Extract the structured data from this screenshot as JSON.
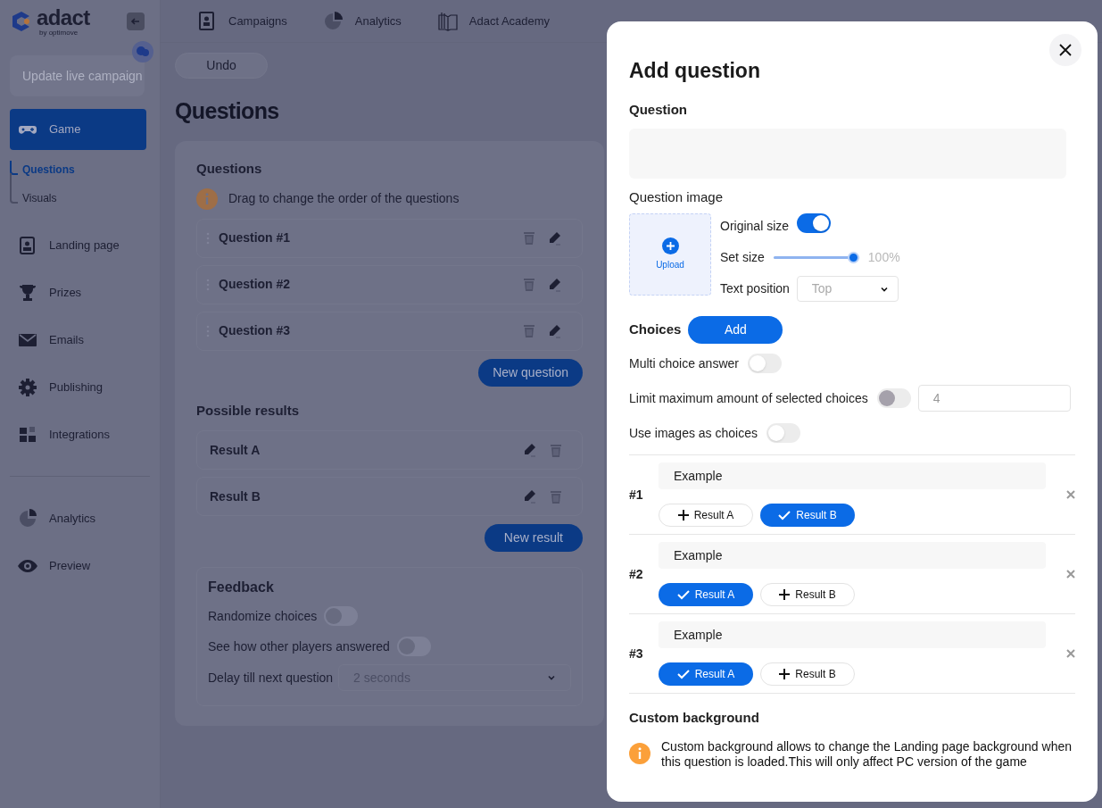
{
  "sidebar": {
    "logo": "adact",
    "logo_sub": "by optimove",
    "update_button": {
      "label": "Update live campaign",
      "disabled": true
    },
    "items": [
      {
        "label": "Game",
        "selected": true,
        "children": [
          {
            "label": "Questions",
            "selected": true
          },
          {
            "label": "Visuals",
            "selected": false
          }
        ]
      },
      {
        "label": "Landing page",
        "selected": false
      },
      {
        "label": "Prizes",
        "selected": false
      },
      {
        "label": "Emails",
        "selected": false
      },
      {
        "label": "Publishing",
        "selected": false
      },
      {
        "label": "Integrations",
        "selected": false
      }
    ],
    "bottom_items": [
      {
        "label": "Analytics",
        "selected": false
      },
      {
        "label": "Preview",
        "selected": false
      }
    ]
  },
  "top_nav": [
    "Campaigns",
    "Analytics",
    "Adact Academy"
  ],
  "undo_button": "Undo",
  "page_title": "Questions",
  "questions_section": {
    "title": "Questions",
    "hint": "Drag to change the order of the questions",
    "rows": [
      "Question #1",
      "Question #2",
      "Question #3"
    ],
    "new_button": "New question"
  },
  "results_section": {
    "title": "Possible results",
    "rows": [
      "Result A",
      "Result B"
    ],
    "new_button": "New result"
  },
  "feedback": {
    "title": "Feedback",
    "toggles": [
      {
        "label": "Randomize choices",
        "on": false
      },
      {
        "label": "See how other players answered",
        "on": false
      }
    ],
    "delay_label": "Delay till next question",
    "delay_value": "2 seconds"
  },
  "dialog": {
    "title": "Add question",
    "question_label": "Question",
    "image_label": "Question image",
    "upload_label": "Upload",
    "original_size": {
      "label": "Original size",
      "on": true
    },
    "set_size": {
      "label": "Set size",
      "level": 1,
      "reading": "100%"
    },
    "text_position": {
      "label": "Text position",
      "value": "Top"
    },
    "choices_label": "Choices",
    "add_button": "Add",
    "options": [
      {
        "label": "Multi choice answer",
        "on": false,
        "disabled": false
      },
      {
        "label": "Limit maximum amount of selected choices",
        "on": false,
        "disabled": true,
        "value": "4"
      },
      {
        "label": "Use images as choices",
        "on": false,
        "disabled": false
      }
    ],
    "choices": [
      {
        "number": "#1",
        "text": "Example",
        "results": [
          {
            "label": "Result A",
            "selected": false
          },
          {
            "label": "Result B",
            "selected": true
          }
        ]
      },
      {
        "number": "#2",
        "text": "Example",
        "results": [
          {
            "label": "Result A",
            "selected": true
          },
          {
            "label": "Result B",
            "selected": false
          }
        ]
      },
      {
        "number": "#3",
        "text": "Example",
        "results": [
          {
            "label": "Result A",
            "selected": true
          },
          {
            "label": "Result B",
            "selected": false
          }
        ]
      }
    ],
    "custom_background_title": "Custom background",
    "custom_background_info": "Custom background allows to change the Landing page background when this question is loaded.This will only affect PC version of the game"
  }
}
